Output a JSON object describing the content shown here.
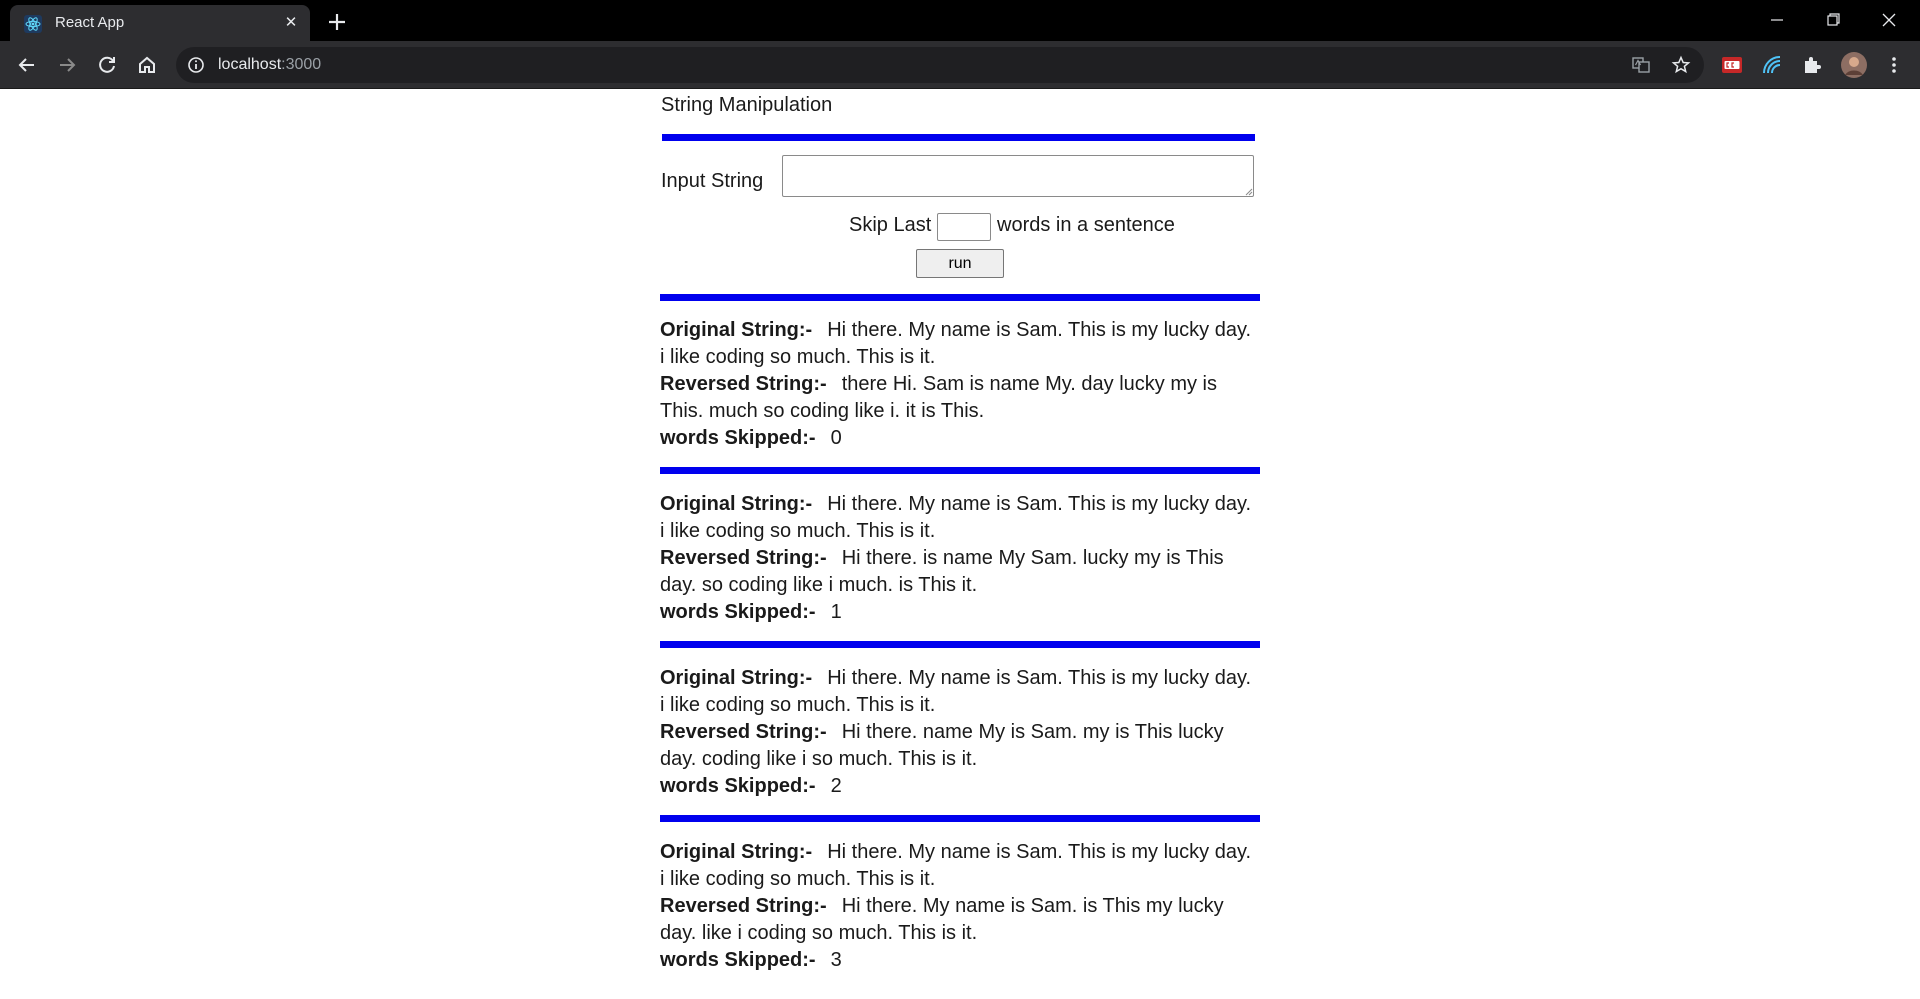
{
  "browser": {
    "tab_title": "React App",
    "tab_close": "✕",
    "url_host": "localhost",
    "url_port": ":3000"
  },
  "app": {
    "title": "String Manipulation",
    "input_label": "Input String",
    "input_value": "",
    "skip_label_before": "Skip Last",
    "skip_value": "",
    "skip_label_after": "words in a sentence",
    "run_label": "run",
    "bar_color": "#0000ee"
  },
  "labels": {
    "original": "Original String:-",
    "reversed": "Reversed String:-",
    "skipped": "words Skipped:-"
  },
  "results": [
    {
      "original": "Hi there. My name is Sam. This is my lucky day. i like coding so much. This is it.",
      "reversed": "there Hi. Sam is name My. day lucky my is This. much so coding like i. it is This.",
      "skipped": "0"
    },
    {
      "original": "Hi there. My name is Sam. This is my lucky day. i like coding so much. This is it.",
      "reversed": "Hi there. is name My Sam. lucky my is This day. so coding like i much. is This it.",
      "skipped": "1"
    },
    {
      "original": "Hi there. My name is Sam. This is my lucky day. i like coding so much. This is it.",
      "reversed": "Hi there. name My is Sam. my is This lucky day. coding like i so much. This is it.",
      "skipped": "2"
    },
    {
      "original": "Hi there. My name is Sam. This is my lucky day. i like coding so much. This is it.",
      "reversed": "Hi there. My name is Sam. is This my lucky day. like i coding so much. This is it.",
      "skipped": "3"
    }
  ],
  "icons": {
    "favicon": "react-icon",
    "back": "arrow-left-icon",
    "forward": "arrow-right-icon",
    "reload": "reload-icon",
    "home": "home-icon",
    "info": "info-icon",
    "translate": "translate-icon",
    "star": "star-icon",
    "extensions": "puzzle-icon",
    "menu": "kebab-menu-icon"
  }
}
